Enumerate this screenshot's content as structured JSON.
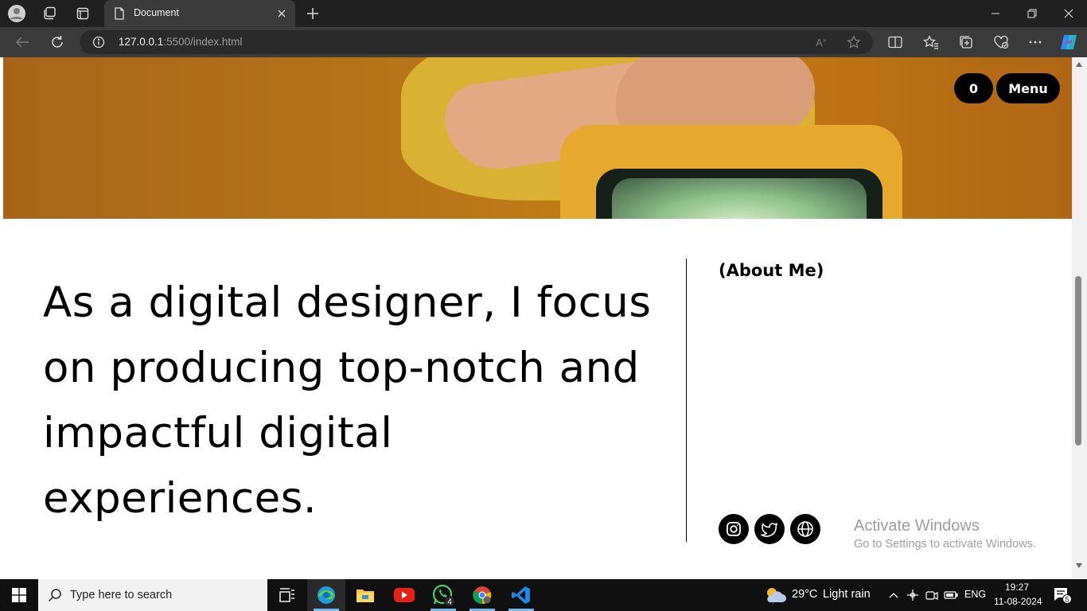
{
  "browser": {
    "tab_title": "Document",
    "url_host": "127.0.0.1",
    "url_path": ":5500/index.html"
  },
  "page": {
    "cart_count": "0",
    "menu_label": "Menu",
    "headline": "As a digital designer, I focus on producing top-notch and impactful digital experiences.",
    "about_label": "(About Me)",
    "social_icons": [
      "instagram-icon",
      "twitter-icon",
      "globe-icon"
    ]
  },
  "watermark": {
    "title": "Activate Windows",
    "subtitle": "Go to Settings to activate Windows."
  },
  "taskbar": {
    "search_placeholder": "Type here to search",
    "whatsapp_badge": "4",
    "weather_temp": "29°C",
    "weather_desc": "Light rain",
    "language": "ENG",
    "time": "19:27",
    "date": "11-08-2024",
    "notification_count": "5"
  },
  "colors": {
    "hero_orange": "#b97518",
    "accent_blue": "#76b9ed"
  }
}
